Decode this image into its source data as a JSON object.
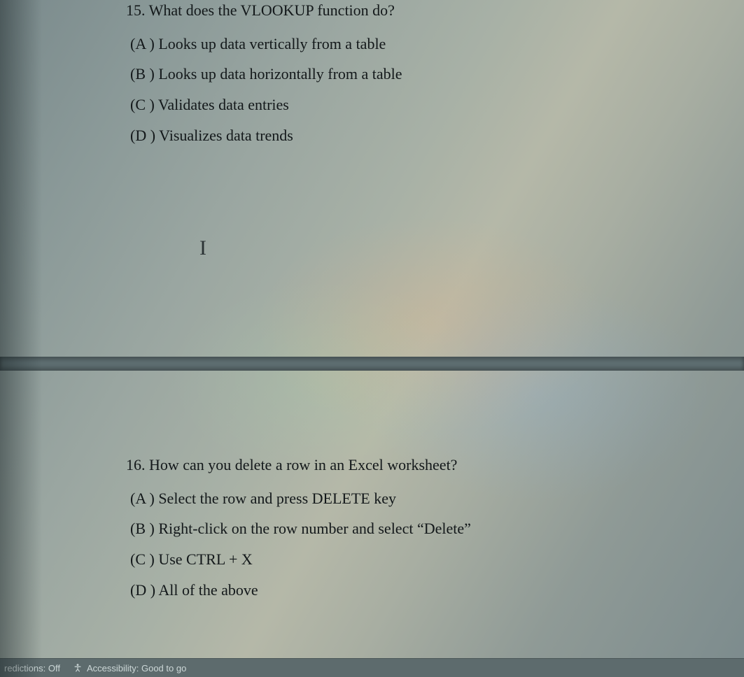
{
  "questions": {
    "q15": {
      "number": "15.",
      "text": "What does the VLOOKUP function do?",
      "options": {
        "A": "(A ) Looks up data vertically from a table",
        "B": "(B ) Looks up data horizontally from a table",
        "C": "(C ) Validates data entries",
        "D": "(D ) Visualizes data trends"
      }
    },
    "q16": {
      "number": "16.",
      "text": "How can you delete a row in an Excel worksheet?",
      "options": {
        "A": "(A ) Select the row and press DELETE key",
        "B": "(B ) Right-click on the row number and select “Delete”",
        "C": "(C ) Use CTRL + X",
        "D": "(D ) All of the above"
      }
    }
  },
  "cursor_glyph": "I",
  "statusbar": {
    "predictions": "redictions: Off",
    "accessibility": "Accessibility: Good to go"
  }
}
